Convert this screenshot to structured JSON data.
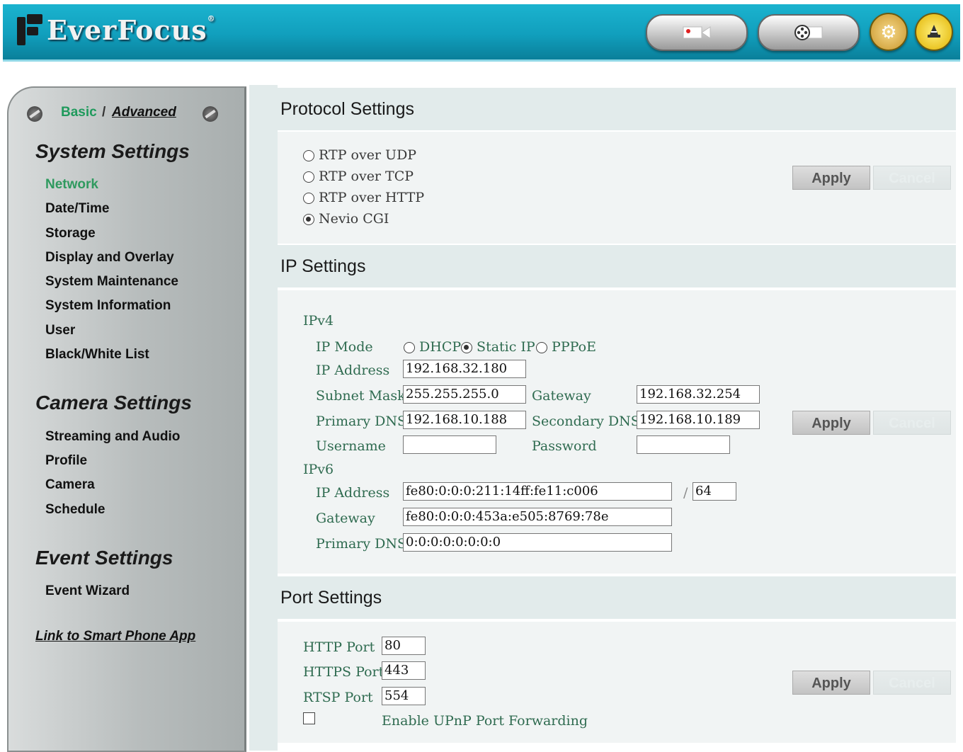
{
  "header": {
    "brand": "EverFocus",
    "brand_mark": "®",
    "buttons": [
      {
        "name": "live-view-icon"
      },
      {
        "name": "playback-icon"
      },
      {
        "name": "settings-gear-icon"
      },
      {
        "name": "wizard-icon"
      }
    ]
  },
  "sidebar": {
    "mode": {
      "basic": "Basic",
      "separator": "/",
      "advanced": "Advanced"
    },
    "system": {
      "title": "System Settings",
      "items": [
        "Network",
        "Date/Time",
        "Storage",
        "Display and Overlay",
        "System Maintenance",
        "System Information",
        "User",
        "Black/White List"
      ]
    },
    "camera": {
      "title": "Camera Settings",
      "items": [
        "Streaming and Audio",
        "Profile",
        "Camera",
        "Schedule"
      ]
    },
    "event": {
      "title": "Event Settings",
      "items": [
        "Event Wizard"
      ]
    },
    "smart_link": "Link to Smart Phone App"
  },
  "protocol": {
    "title": "Protocol Settings",
    "options": [
      "RTP over UDP",
      "RTP over TCP",
      "RTP over HTTP",
      "Nevio CGI"
    ],
    "selected": "Nevio CGI",
    "apply": "Apply",
    "cancel": "Cancel"
  },
  "ip": {
    "title": "IP Settings",
    "ipv4_label": "IPv4",
    "ip_mode_label": "IP Mode",
    "ip_mode_options": [
      "DHCP",
      "Static IP",
      "PPPoE"
    ],
    "ip_mode_selected": "Static IP",
    "ip_address_label": "IP Address",
    "ip_address": "192.168.32.180",
    "subnet_label": "Subnet Mask",
    "subnet": "255.255.255.0",
    "gateway_label": "Gateway",
    "gateway": "192.168.32.254",
    "primary_dns_label": "Primary DNS",
    "primary_dns": "192.168.10.188",
    "secondary_dns_label": "Secondary DNS",
    "secondary_dns": "192.168.10.189",
    "username_label": "Username",
    "username": "",
    "password_label": "Password",
    "password": "",
    "ipv6_label": "IPv6",
    "ipv6_address_label": "IP Address",
    "ipv6_address": "fe80:0:0:0:211:14ff:fe11:c006",
    "prefix_sep": "/",
    "ipv6_prefix": "64",
    "ipv6_gateway_label": "Gateway",
    "ipv6_gateway": "fe80:0:0:0:453a:e505:8769:78e",
    "ipv6_dns_label": "Primary DNS",
    "ipv6_dns": "0:0:0:0:0:0:0:0",
    "apply": "Apply",
    "cancel": "Cancel"
  },
  "port": {
    "title": "Port Settings",
    "http_label": "HTTP Port",
    "http": "80",
    "https_label": "HTTPS Port",
    "https": "443",
    "rtsp_label": "RTSP Port",
    "rtsp": "554",
    "upnp_label": "Enable UPnP Port Forwarding",
    "upnp_checked": false,
    "apply": "Apply",
    "cancel": "Cancel"
  }
}
